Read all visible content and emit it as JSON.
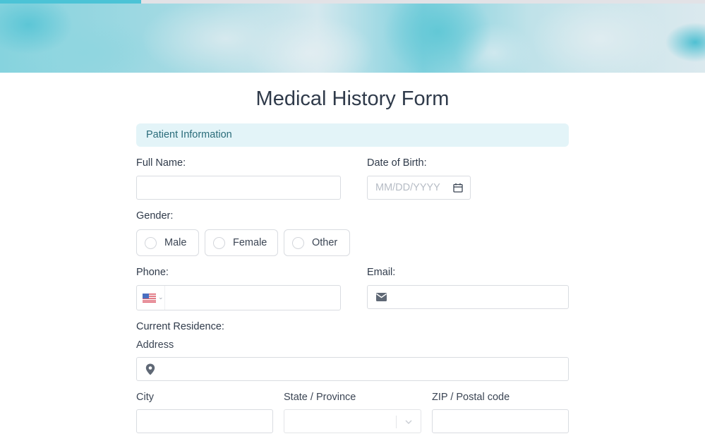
{
  "progress": {
    "fraction": 0.2,
    "color": "#4bc3d6"
  },
  "form": {
    "title": "Medical History Form",
    "section": "Patient Information",
    "full_name": {
      "label": "Full Name:",
      "value": ""
    },
    "dob": {
      "label": "Date of Birth:",
      "placeholder": "MM/DD/YYYY",
      "icon": "calendar-icon"
    },
    "gender": {
      "label": "Gender:",
      "options": [
        "Male",
        "Female",
        "Other"
      ],
      "selected": null
    },
    "phone": {
      "label": "Phone:",
      "country": "US",
      "flag_icon": "us-flag-icon",
      "value": ""
    },
    "email": {
      "label": "Email:",
      "icon": "envelope-icon",
      "value": ""
    },
    "residence": {
      "label": "Current Residence:",
      "address": {
        "label": "Address",
        "icon": "map-pin-icon",
        "value": ""
      },
      "city": {
        "label": "City",
        "value": ""
      },
      "state": {
        "label": "State / Province",
        "value": ""
      },
      "zip": {
        "label": "ZIP / Postal code",
        "value": ""
      }
    }
  }
}
